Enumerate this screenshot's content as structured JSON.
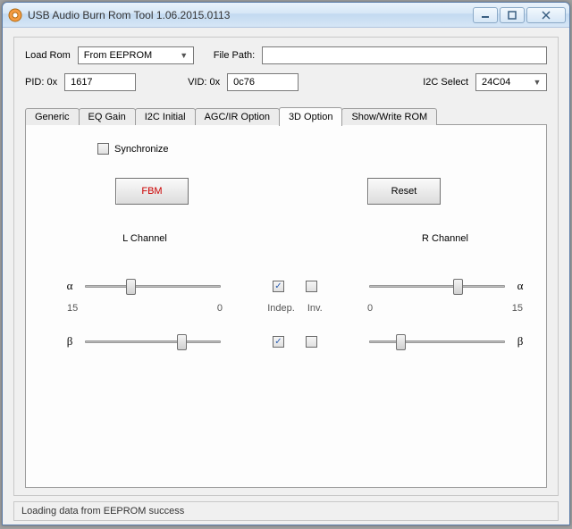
{
  "window": {
    "title": "USB Audio Burn Rom Tool 1.06.2015.0113"
  },
  "top": {
    "load_rom_label": "Load Rom",
    "load_rom_value": "From EEPROM",
    "file_path_label": "File Path:",
    "file_path_value": "",
    "pid_label": "PID:  0x",
    "pid_value": "1617",
    "vid_label": "VID:  0x",
    "vid_value": "0c76",
    "i2c_label": "I2C Select",
    "i2c_value": "24C04"
  },
  "tabs": {
    "items": [
      "Generic",
      "EQ Gain",
      "I2C Initial",
      "AGC/IR Option",
      "3D Option",
      "Show/Write ROM"
    ],
    "active_index": 4
  },
  "panel": {
    "sync_label": "Synchronize",
    "sync_checked": false,
    "fbm_label": "FBM",
    "reset_label": "Reset",
    "l_channel_label": "L Channel",
    "r_channel_label": "R Channel",
    "alpha": "α",
    "beta": "β",
    "indep_label": "Indep.",
    "inv_label": "Inv.",
    "l_scale_left": "15",
    "l_scale_right": "0",
    "r_scale_left": "0",
    "r_scale_right": "15",
    "indep_alpha_checked": true,
    "inv_alpha_checked": false,
    "indep_beta_checked": true,
    "inv_beta_checked": false
  },
  "status": {
    "text": "Loading data from EEPROM success"
  }
}
